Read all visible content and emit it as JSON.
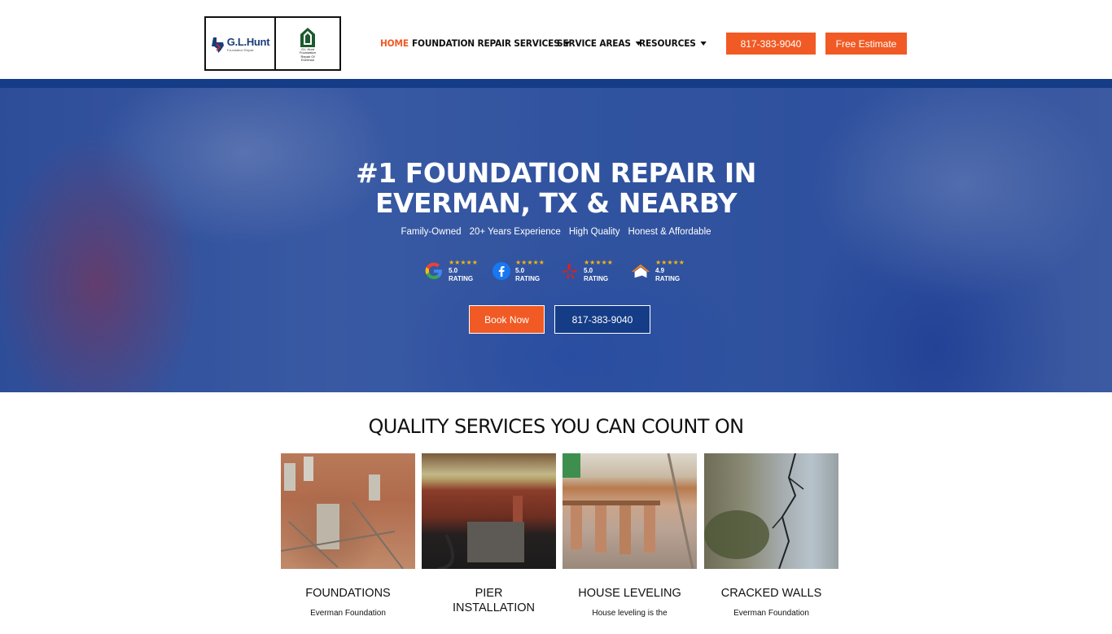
{
  "header": {
    "logo": {
      "brand_name": "G.L.Hunt",
      "brand_tag": "Foundation Repair",
      "secondary_lines": [
        "G.L Hunt",
        "Foundation",
        "Repair Of",
        "Everman"
      ]
    },
    "nav": {
      "home": "HOME",
      "foundation_repair": "FOUNDATION REPAIR SERVICES",
      "service_areas": "SERVICE AREAS",
      "resources": "RESOURCES"
    },
    "phone_button": "817-383-9040",
    "estimate_button": "Free Estimate"
  },
  "hero": {
    "title_line1": "#1 FOUNDATION REPAIR IN",
    "title_line2": "EVERMAN, TX & NEARBY",
    "features": [
      "Family-Owned",
      "20+ Years Experience",
      "High Quality",
      "Honest & Affordable"
    ],
    "ratings": [
      {
        "source_icon": "google-icon",
        "stars": "★★★★★",
        "label": "5.0 RATING"
      },
      {
        "source_icon": "facebook-icon",
        "stars": "★★★★★",
        "label": "5.0 RATING"
      },
      {
        "source_icon": "yelp-icon",
        "stars": "★★★★★",
        "label": "5.0 RATING"
      },
      {
        "source_icon": "homeadvisor-icon",
        "stars": "★★★★★",
        "label": "4.9 RATING"
      }
    ],
    "book_button": "Book Now",
    "phone_button": "817-383-9040"
  },
  "services": {
    "title": "QUALITY SERVICES YOU CAN COUNT ON",
    "cards": [
      {
        "title": "FOUNDATIONS",
        "desc": "Everman Foundation"
      },
      {
        "title": "PIER INSTALLATION",
        "desc": ""
      },
      {
        "title": "HOUSE LEVELING",
        "desc": "House leveling is the"
      },
      {
        "title": "CRACKED WALLS",
        "desc": "Everman Foundation"
      }
    ]
  },
  "colors": {
    "accent_orange": "#f15a24",
    "brand_blue": "#153c87"
  }
}
